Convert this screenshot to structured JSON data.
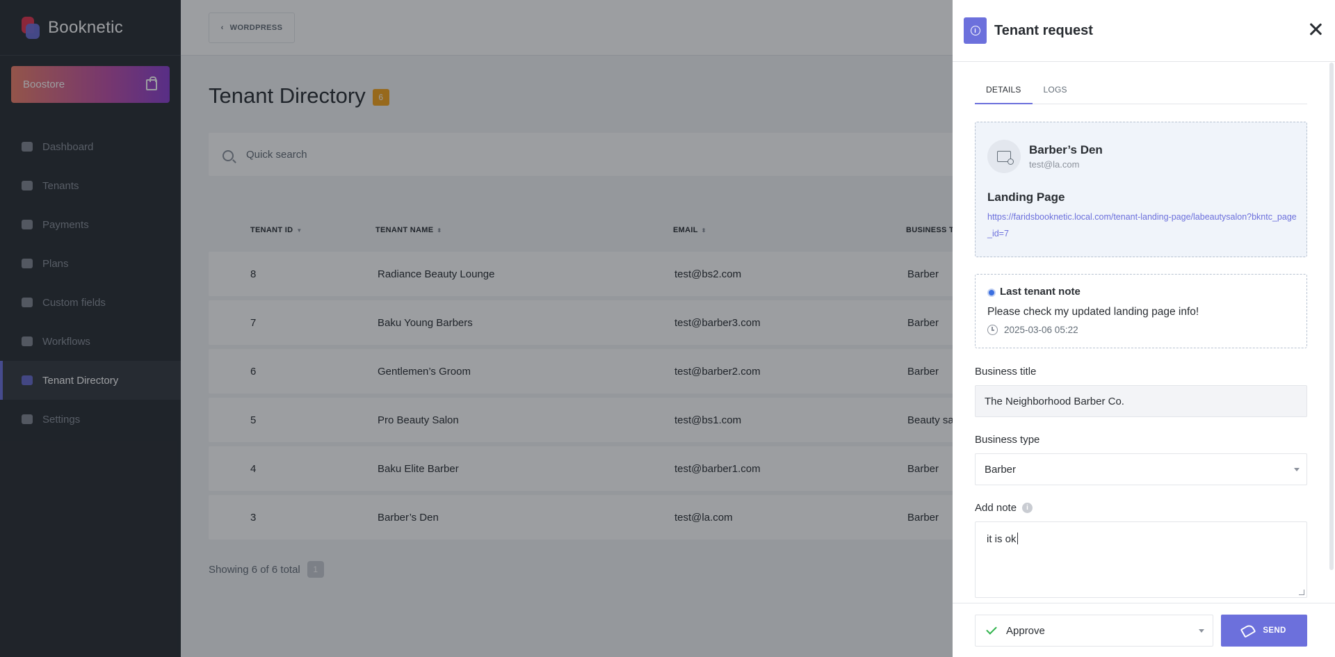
{
  "brand": {
    "name": "Booknetic"
  },
  "boostore": {
    "label": "Boostore"
  },
  "sidebar": {
    "items": [
      {
        "label": "Dashboard",
        "icon": "dashboard-icon"
      },
      {
        "label": "Tenants",
        "icon": "user-icon"
      },
      {
        "label": "Payments",
        "icon": "credit-card-icon"
      },
      {
        "label": "Plans",
        "icon": "rocket-icon"
      },
      {
        "label": "Custom fields",
        "icon": "edit-icon"
      },
      {
        "label": "Workflows",
        "icon": "workflow-icon"
      },
      {
        "label": "Tenant Directory",
        "icon": "laptop-icon",
        "active": true
      },
      {
        "label": "Settings",
        "icon": "gear-icon"
      }
    ]
  },
  "topbar": {
    "back_label": "WORDPRESS"
  },
  "page": {
    "title": "Tenant Directory",
    "count": "6"
  },
  "search": {
    "placeholder": "Quick search"
  },
  "table": {
    "columns": [
      "TENANT ID",
      "TENANT NAME",
      "EMAIL",
      "BUSINESS TY"
    ],
    "rows": [
      {
        "id": "8",
        "name": "Radiance Beauty Lounge",
        "email": "test@bs2.com",
        "type": "Barber"
      },
      {
        "id": "7",
        "name": "Baku Young Barbers",
        "email": "test@barber3.com",
        "type": "Barber"
      },
      {
        "id": "6",
        "name": "Gentlemen’s Groom",
        "email": "test@barber2.com",
        "type": "Barber"
      },
      {
        "id": "5",
        "name": "Pro Beauty Salon",
        "email": "test@bs1.com",
        "type": "Beauty sa"
      },
      {
        "id": "4",
        "name": "Baku Elite Barber",
        "email": "test@barber1.com",
        "type": "Barber"
      },
      {
        "id": "3",
        "name": "Barber’s Den",
        "email": "test@la.com",
        "type": "Barber"
      }
    ],
    "footer": "Showing 6 of 6 total",
    "page": "1"
  },
  "panel": {
    "title": "Tenant request",
    "tabs": [
      "DETAILS",
      "LOGS"
    ],
    "tenant_name": "Barber’s Den",
    "tenant_email": "test@la.com",
    "landing_title": "Landing Page",
    "landing_url": "https://faridsbooknetic.local.com/tenant-landing-page/labeautysalon?bkntc_page_id=7",
    "note_label": "Last tenant note",
    "note_text": "Please check my updated landing page info!",
    "note_time": "2025-03-06 05:22",
    "business_title_label": "Business title",
    "business_title_value": "The Neighborhood Barber Co.",
    "business_type_label": "Business type",
    "business_type_value": "Barber",
    "add_note_label": "Add note",
    "add_note_value": "it is ok",
    "status_value": "Approve",
    "send_label": "SEND"
  },
  "colors": {
    "accent": "#6c70dc",
    "sidebar": "#292d32",
    "badge": "#f7a41b",
    "approve": "#2fb34b"
  }
}
